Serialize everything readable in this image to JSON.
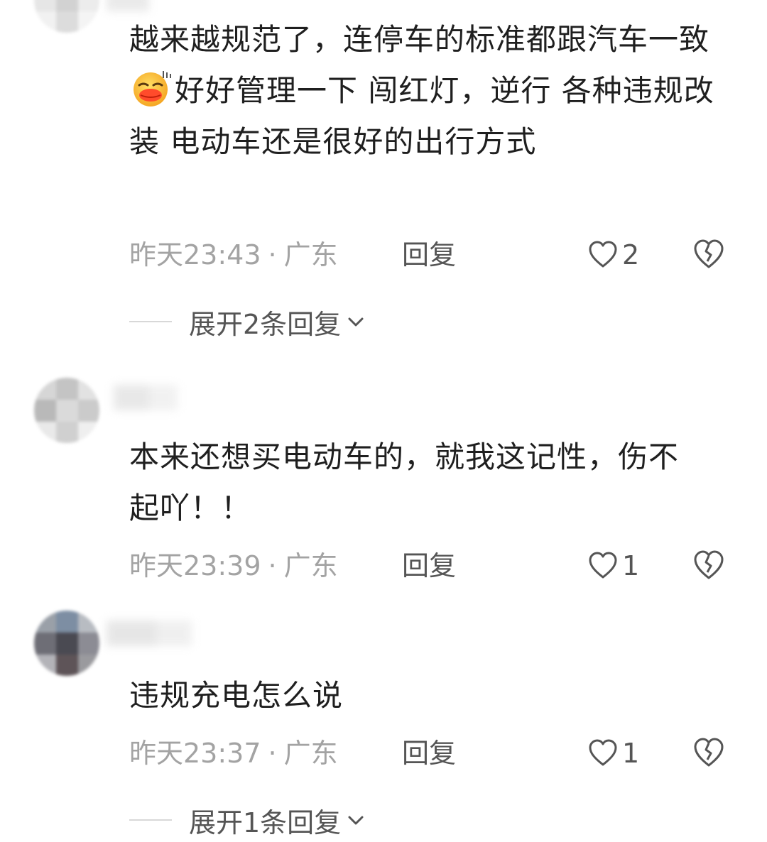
{
  "comments": [
    {
      "text_parts": [
        "越来越规范了，连停车的标准都跟汽车一致",
        "好好管理一下 闯红灯，逆行 各种违规改装  电动车还是很好的出行方式"
      ],
      "emoji": "kissing-emoji",
      "time": "昨天23:43",
      "dot": "·",
      "region": "广东",
      "reply_label": "回复",
      "likes": "2",
      "expand_label": "展开2条回复"
    },
    {
      "text": "本来还想买电动车的，就我这记性，伤不起吖！！",
      "time": "昨天23:39",
      "dot": "·",
      "region": "广东",
      "reply_label": "回复",
      "likes": "1"
    },
    {
      "text": "违规充电怎么说",
      "time": "昨天23:37",
      "dot": "·",
      "region": "广东",
      "reply_label": "回复",
      "likes": "1",
      "expand_label": "展开1条回复"
    }
  ],
  "colors": {
    "text": "#1f1f1f",
    "meta": "#a3a3a3",
    "action": "#555555"
  }
}
